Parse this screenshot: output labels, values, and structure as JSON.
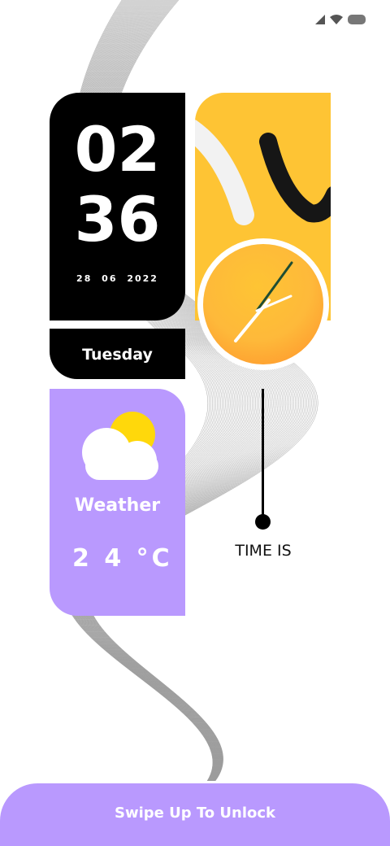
{
  "status_bar": {
    "icons": [
      "signal-icon",
      "wifi-icon",
      "battery-icon"
    ]
  },
  "clock_widget": {
    "hours": "02",
    "minutes": "36",
    "date": "28 06 2022",
    "day": "Tuesday"
  },
  "weather_widget": {
    "icon": "partly-cloudy-icon",
    "label": "Weather",
    "temperature": "2 4 °C"
  },
  "analog_clock": {
    "time_label": "TIME IS"
  },
  "lock": {
    "swipe_label": "Swipe Up To Unlock"
  },
  "colors": {
    "accent_purple": "#b999fe",
    "accent_yellow": "#fec434",
    "black": "#000000"
  }
}
